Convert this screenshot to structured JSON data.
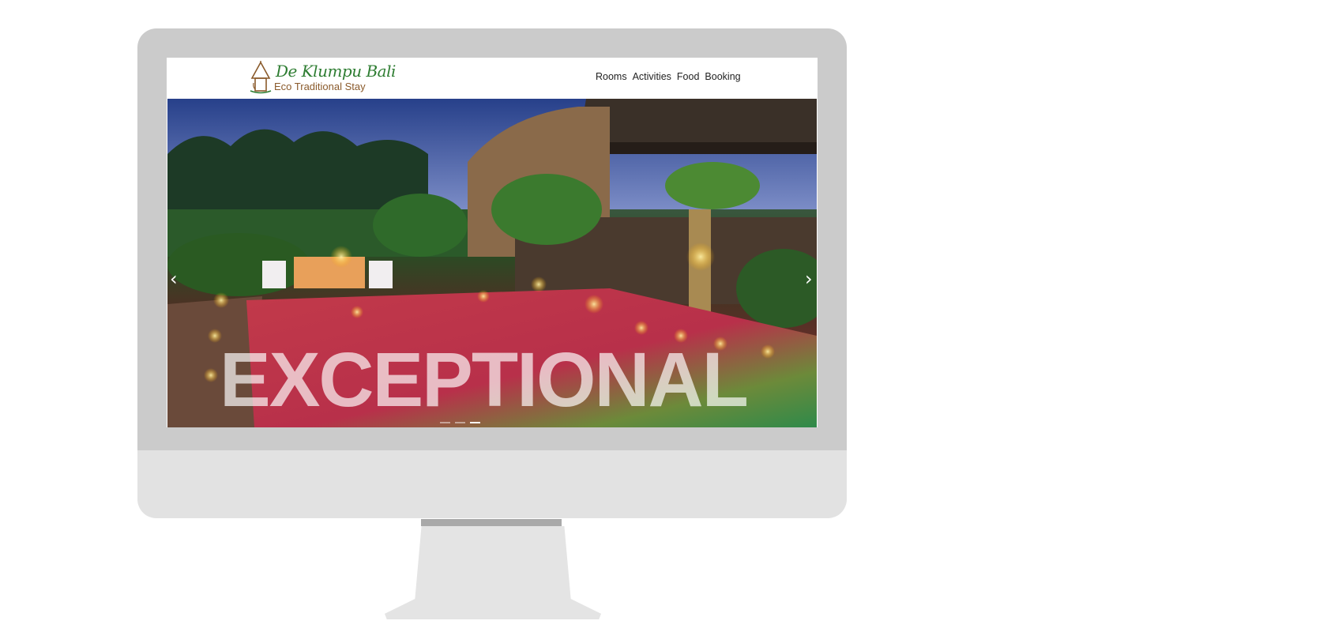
{
  "site": {
    "logo": {
      "name": "De Klumpu Bali",
      "tagline": "Eco Traditional Stay"
    },
    "nav": {
      "items": [
        "Rooms",
        "Activities",
        "Food",
        "Booking"
      ]
    }
  },
  "hero": {
    "headline": "EXCEPTIONAL",
    "prev_icon": "chevron-left-icon",
    "next_icon": "chevron-right-icon",
    "prev_glyph": "‹",
    "next_glyph": "›",
    "slide_count": 3,
    "active_slide": 3
  },
  "colors": {
    "brand_green": "#2e7d32",
    "brand_brown": "#8a5a2b",
    "monitor_frame": "#cbcbcb",
    "monitor_chin": "#e2e2e2"
  }
}
